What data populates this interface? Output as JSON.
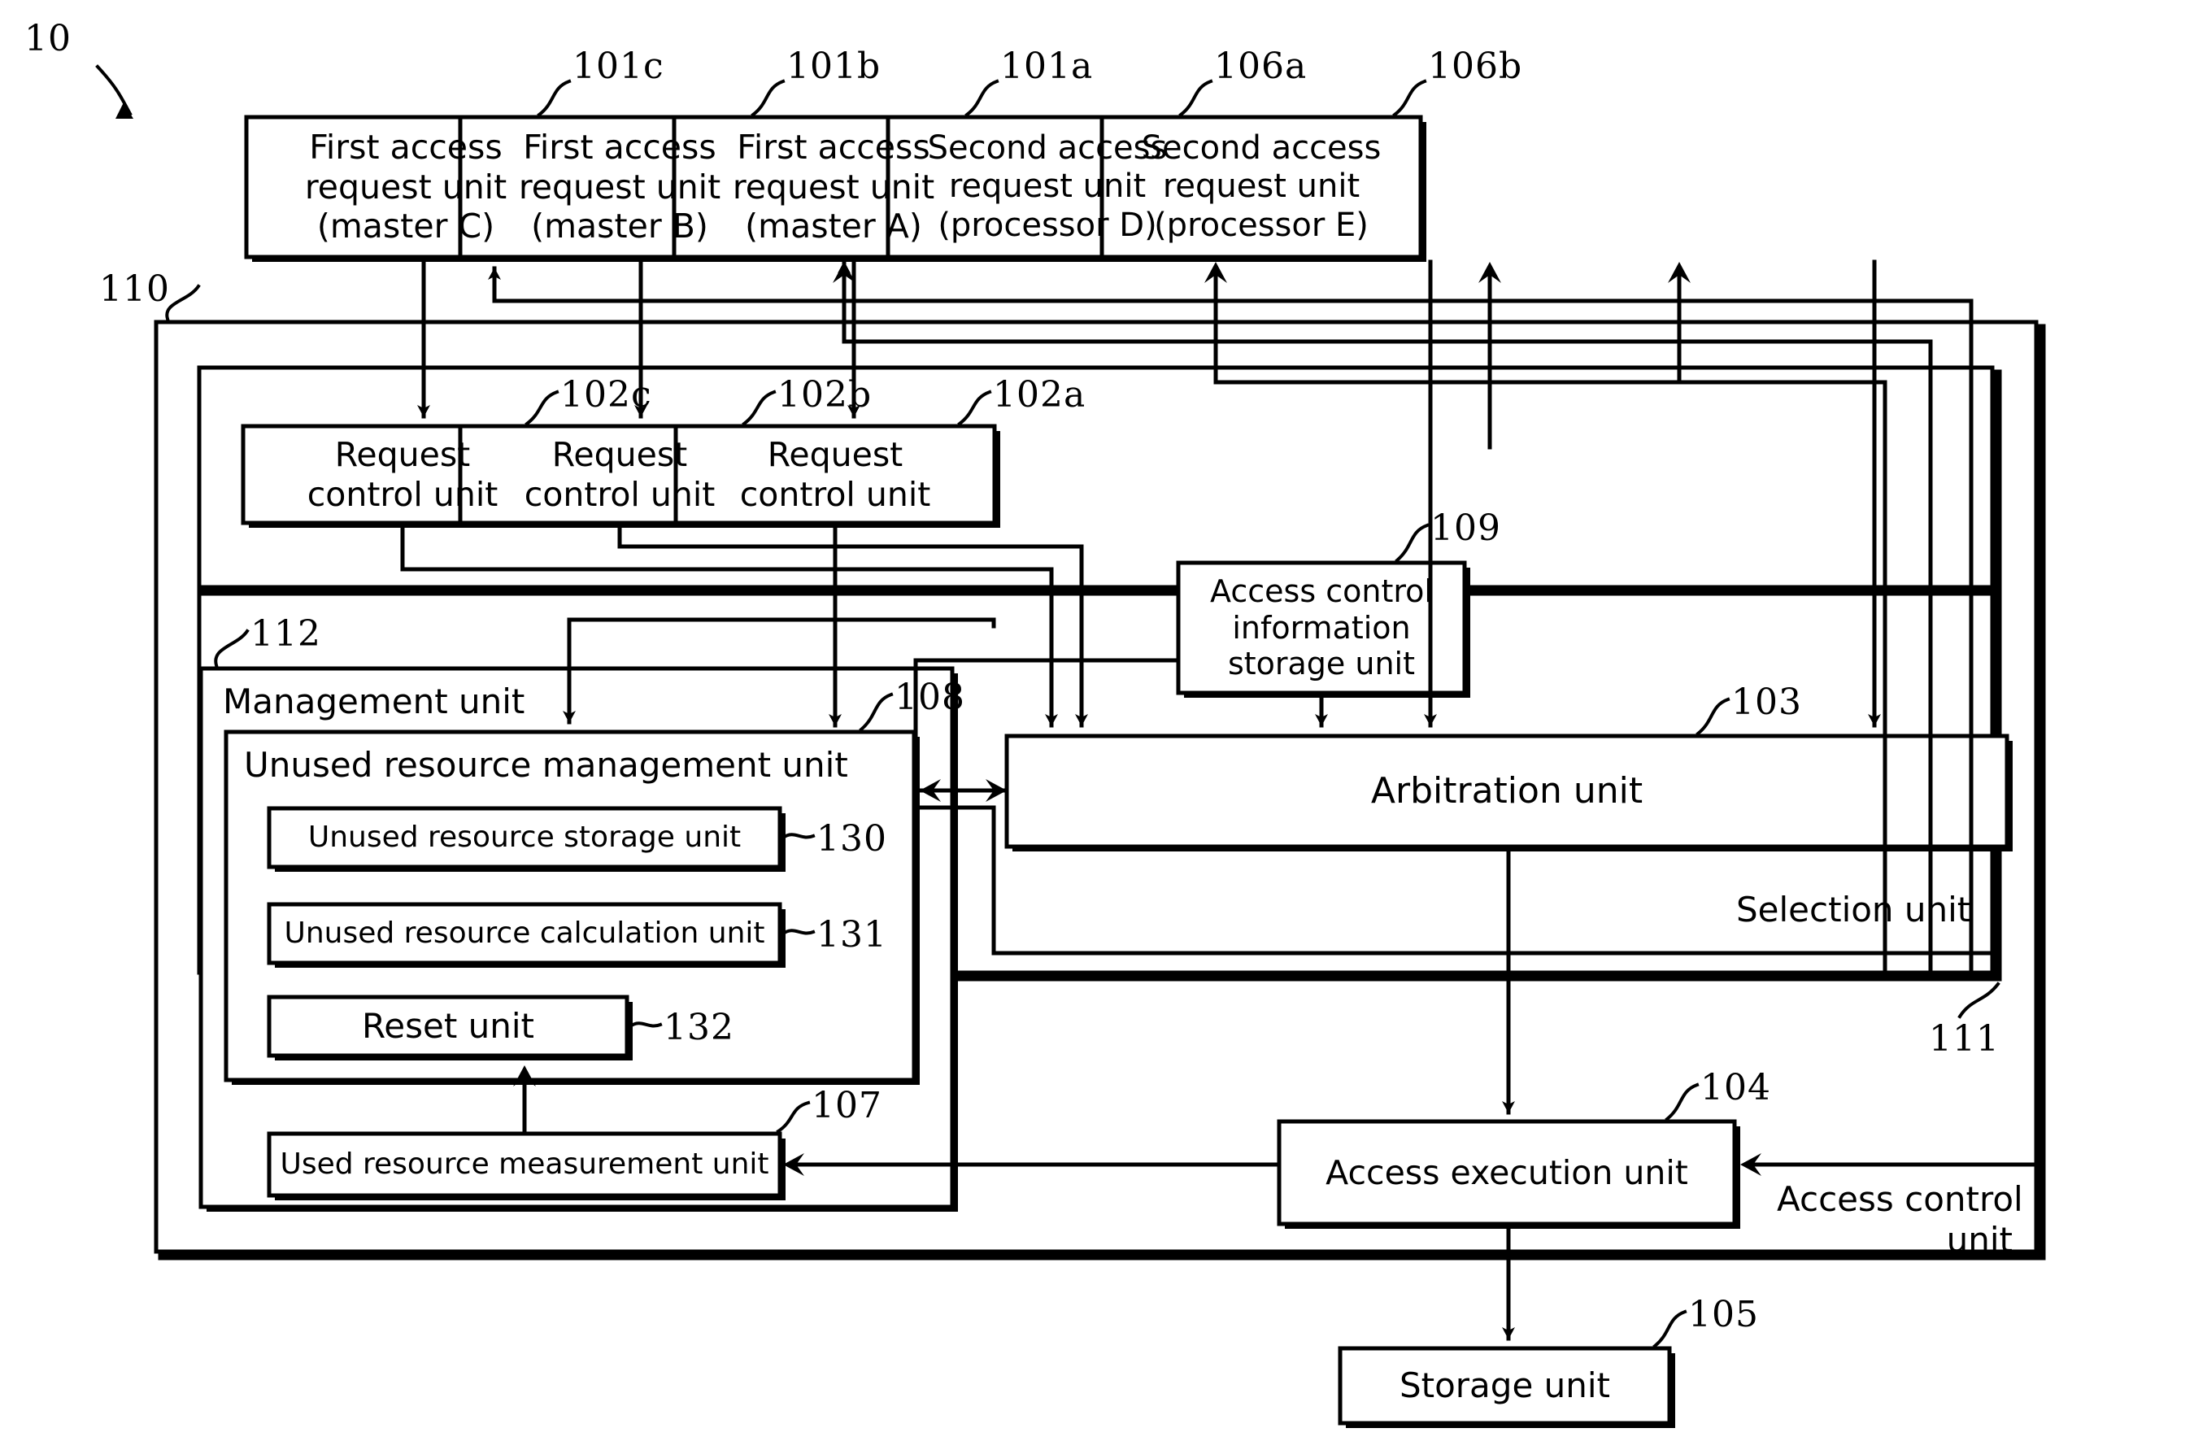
{
  "figure": {
    "ref_main": "10",
    "boxes": {
      "access_req_c": {
        "label": "First access\nrequest unit\n(master C)",
        "ref": "101c"
      },
      "access_req_b": {
        "label": "First access\nrequest unit\n(master B)",
        "ref": "101b"
      },
      "access_req_a": {
        "label": "First access\nrequest unit\n(master A)",
        "ref": "101a"
      },
      "second_req_d": {
        "label": "Second access\nrequest unit\n(processor D)",
        "ref": "106a"
      },
      "second_req_e": {
        "label": "Second access\nrequest unit\n(processor E)",
        "ref": "106b"
      },
      "req_ctrl_c": {
        "label": "Request\ncontrol unit",
        "ref": "102c"
      },
      "req_ctrl_b": {
        "label": "Request\ncontrol unit",
        "ref": "102b"
      },
      "req_ctrl_a": {
        "label": "Request\ncontrol unit",
        "ref": "102a"
      },
      "access_ctrl_info": {
        "label": "Access control\ninformation\nstorage unit",
        "ref": "109"
      },
      "arbitration": {
        "label": "Arbitration unit",
        "ref": "103"
      },
      "management": {
        "label": "Management unit",
        "ref": "112"
      },
      "unused_res_mgmt": {
        "label": "Unused resource management unit",
        "ref": "108"
      },
      "unused_res_storage": {
        "label": "Unused resource storage unit",
        "ref": "130"
      },
      "unused_res_calc": {
        "label": "Unused resource calculation unit",
        "ref": "131"
      },
      "reset": {
        "label": "Reset unit",
        "ref": "132"
      },
      "used_res_meas": {
        "label": "Used resource measurement unit",
        "ref": "107"
      },
      "access_exec": {
        "label": "Access execution unit",
        "ref": "104"
      },
      "storage": {
        "label": "Storage unit",
        "ref": "105"
      },
      "selection": {
        "label": "Selection unit",
        "ref": "111"
      },
      "access_ctrl_unit": {
        "label": "Access control\nunit",
        "ref": "110"
      }
    },
    "colors": {
      "line": "#000000",
      "background": "#ffffff",
      "text": "#000000"
    }
  }
}
